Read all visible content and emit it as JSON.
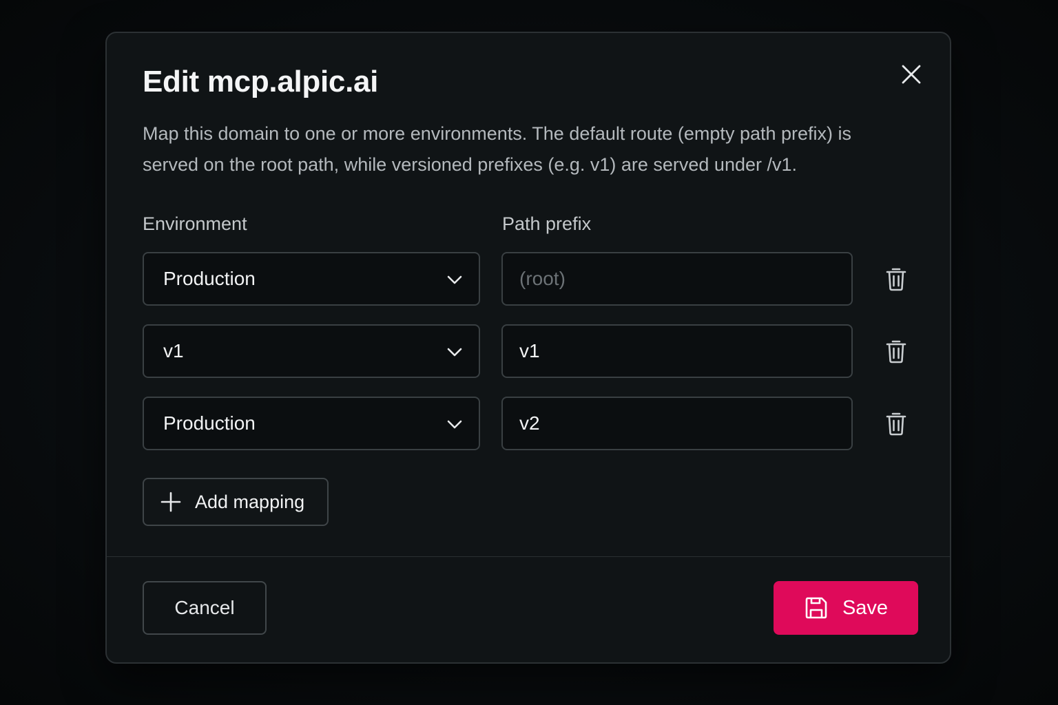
{
  "dialog": {
    "title": "Edit mcp.alpic.ai",
    "description": "Map this domain to one or more environments. The default route (empty path prefix) is served on the root path, while versioned prefixes (e.g. v1) are served under /v1.",
    "close_icon": "close-icon"
  },
  "columns": {
    "environment": "Environment",
    "path_prefix": "Path prefix"
  },
  "mappings": [
    {
      "environment": "Production",
      "path_prefix": "",
      "placeholder": "(root)"
    },
    {
      "environment": "v1",
      "path_prefix": "v1",
      "placeholder": ""
    },
    {
      "environment": "Production",
      "path_prefix": "v2",
      "placeholder": ""
    }
  ],
  "icons": {
    "dropdown": "chevron-down-icon",
    "delete": "trash-icon",
    "add": "plus-icon",
    "save": "floppy-disk-icon"
  },
  "actions": {
    "add_mapping": "Add mapping",
    "cancel": "Cancel",
    "save": "Save"
  },
  "colors": {
    "accent": "#df0a5a",
    "background": "#101416",
    "border": "#3a4043"
  }
}
